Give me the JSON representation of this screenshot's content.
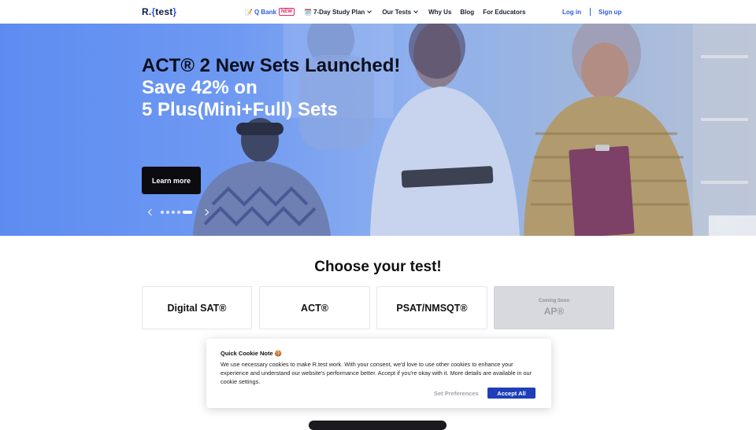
{
  "header": {
    "logo": {
      "left": "R.",
      "brace_open": "{",
      "word": "test",
      "brace_close": "}"
    },
    "nav": [
      {
        "icon": "📝",
        "label": "Q Bank",
        "badge": "NEW"
      },
      {
        "icon": "🗓️",
        "label": "7-Day Study Plan",
        "dropdown": true
      },
      {
        "label": "Our Tests",
        "dropdown": true
      },
      {
        "label": "Why Us"
      },
      {
        "label": "Blog"
      },
      {
        "label": "For Educators"
      }
    ],
    "auth": {
      "login": "Log in",
      "signup": "Sign up"
    }
  },
  "hero": {
    "title": "ACT® 2 New Sets Launched!",
    "subtitle_line1": "Save 42% on",
    "subtitle_line2": "5 Plus(Mini+Full) Sets",
    "cta": "Learn more",
    "carousel": {
      "slide_count": 5,
      "active_index": 4
    }
  },
  "choose": {
    "title": "Choose your test!",
    "cards": [
      {
        "label": "Digital SAT®"
      },
      {
        "label": "ACT®"
      },
      {
        "label": "PSAT/NMSQT®"
      },
      {
        "label": "AP®",
        "status": "Coming Soon"
      }
    ]
  },
  "cookie": {
    "title": "Quick Cookie Note 🍪",
    "text": "We use necessary cookies to make R.test work. With your consent, we'd love to use other cookies to enhance your experience and understand our website's performance better. Accept if you're okay with it. More details are available in our cookie settings.",
    "preferences": "Set Preferences",
    "accept": "Accept All"
  },
  "colors": {
    "brand": "#2d5be3",
    "accept": "#1e3fb8",
    "new_badge": "#e0245e",
    "hero_blue": "#5d8cf1"
  }
}
